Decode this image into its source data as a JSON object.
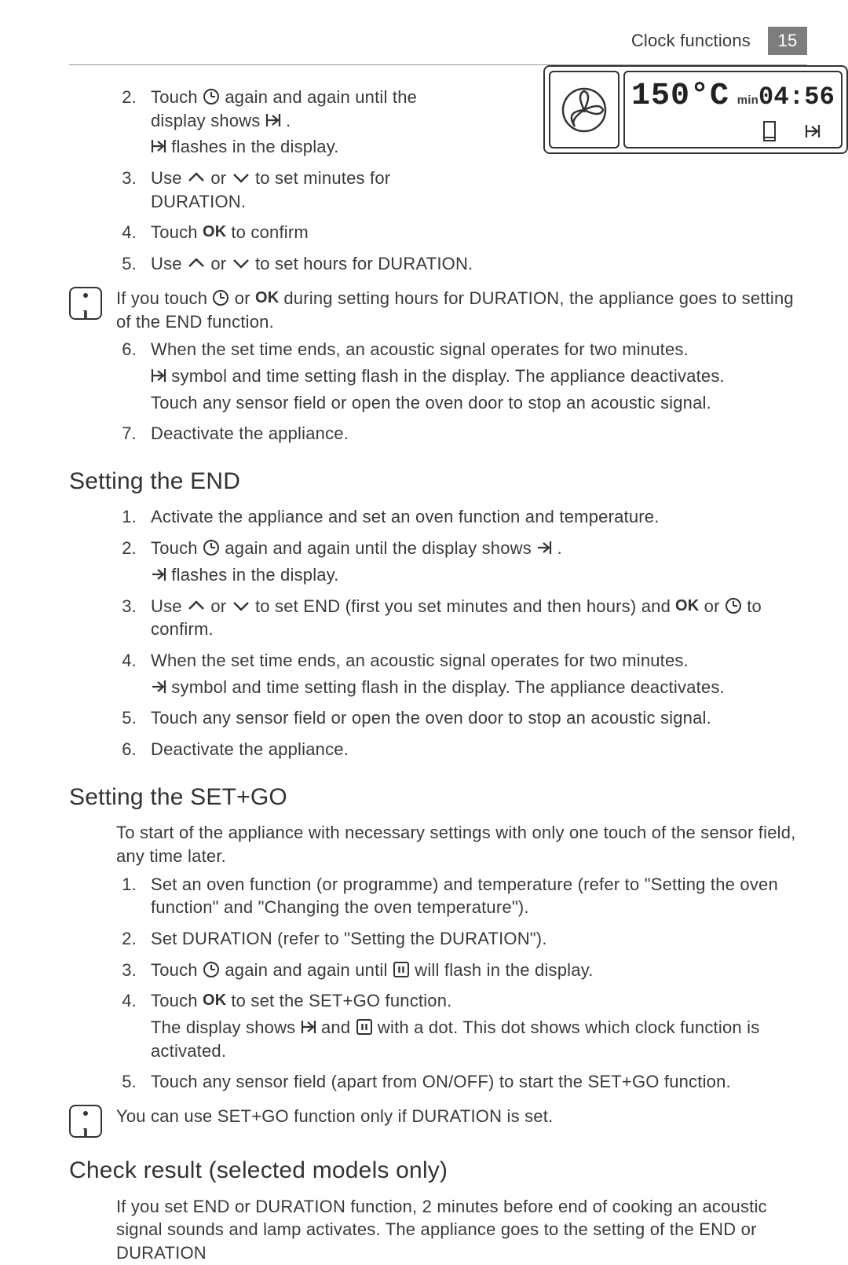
{
  "header": {
    "title": "Clock functions",
    "page": "15"
  },
  "display": {
    "temp": "150°C",
    "min_label": "min",
    "time": "04:56"
  },
  "sec1": {
    "i2a": "Touch ",
    "i2b": " again and again until the display shows ",
    "i2c": " .",
    "i2d": " flashes in the display.",
    "i3a": "Use ",
    "i3b": " or ",
    "i3c": " to set minutes for DURATION.",
    "i4a": "Touch ",
    "i4b": " to confirm",
    "i5a": "Use ",
    "i5b": " or ",
    "i5c": " to set hours for DURATION."
  },
  "info1a": "If you touch ",
  "info1b": " or ",
  "info1c": " during setting hours for DURATION, the appliance goes to setting of the END function.",
  "sec2": {
    "i6a": "When the set time ends, an acoustic signal operates for two minutes.",
    "i6b": " symbol and time setting flash in the display. The appliance deactivates.",
    "i6c": "Touch any sensor field or open the oven door to stop an acoustic signal.",
    "i7": "Deactivate the appliance."
  },
  "end": {
    "heading": "Setting the END",
    "i1": "Activate the appliance and set an oven function and temperature.",
    "i2a": "Touch ",
    "i2b": " again and again until the display shows ",
    "i2c": " .",
    "i2d": " flashes in the display.",
    "i3a": "Use ",
    "i3b": " or ",
    "i3c": " to set END (first you set minutes and then hours) and ",
    "i3d": " or ",
    "i3e": " to confirm.",
    "i4a": "When the set time ends, an acoustic signal operates for two minutes.",
    "i4b": " symbol and time setting flash in the display. The appliance deactivates.",
    "i5": "Touch any sensor field or open the oven door to stop an acoustic signal.",
    "i6": "Deactivate the appliance."
  },
  "setgo": {
    "heading": "Setting the SET+GO",
    "intro": "To start of the appliance with necessary settings with only one touch of the sensor field, any time later.",
    "i1": "Set an oven function (or programme) and temperature (refer to \"Setting the oven function\" and \"Changing the oven temperature\").",
    "i2": "Set DURATION (refer to \"Setting the DURATION\").",
    "i3a": "Touch ",
    "i3b": " again and again until ",
    "i3c": " will flash in the display.",
    "i4a": "Touch ",
    "i4b": " to set the SET+GO function.",
    "i4c": "The display shows ",
    "i4d": " and ",
    "i4e": " with a dot. This dot shows which clock function is activated.",
    "i5": "Touch any sensor field (apart from ON/OFF) to start the SET+GO function."
  },
  "info2": "You can use SET+GO function only if DURATION is set.",
  "check": {
    "heading": "Check result (selected models only)",
    "body": "If you set END or DURATION function, 2 minutes before end of cooking an acoustic signal sounds and lamp activates. The appliance goes to the setting of the END or DURATION"
  },
  "num": {
    "n1": "1.",
    "n2": "2.",
    "n3": "3.",
    "n4": "4.",
    "n5": "5.",
    "n6": "6.",
    "n7": "7."
  }
}
